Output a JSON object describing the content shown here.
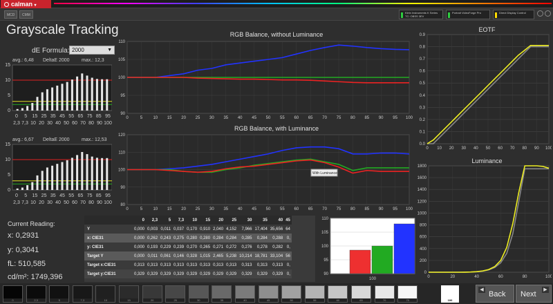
{
  "app": {
    "logo_text": "calman",
    "tabs": [
      "MCD",
      "CMM"
    ]
  },
  "toolbar": {
    "devices": [
      {
        "line1": "Klein Instruments K Series",
        "line2": "TC: OBSS 3EV",
        "color": "#2ecc40"
      },
      {
        "line1": "Portrait VideoForge Pro",
        "line2": "",
        "color": "#2ecc40"
      },
      {
        "line1": "Direct Display Control",
        "line2": "",
        "color": "#ffdc00"
      }
    ]
  },
  "page": {
    "title": "Grayscale Tracking",
    "de_formula_label": "dE Formula:",
    "de_formula_value": "2000"
  },
  "mini_charts": [
    {
      "avg": "avg.: 6,48",
      "label": "DeltaE 2000",
      "max": "max.: 12,3",
      "values": [
        0.5,
        0.8,
        1.5,
        2.5,
        4.5,
        6,
        7,
        7.6,
        8.2,
        8.8,
        9.4,
        10.2,
        11.2,
        12.2,
        11.5,
        10.8,
        10.4,
        10.3,
        10.3
      ],
      "yticks": [
        "15",
        "10",
        "5",
        "0"
      ],
      "xticks_row1": [
        "0",
        "5",
        "15",
        "25",
        "35",
        "45",
        "55",
        "65",
        "75",
        "85",
        "95"
      ],
      "xticks_row2": [
        "2,3",
        "7,3",
        "10",
        "20",
        "30",
        "40",
        "50",
        "60",
        "70",
        "80",
        "90",
        "100"
      ]
    },
    {
      "avg": "avg.: 6,67",
      "label": "DeltaE 2000",
      "max": "max.: 12,53",
      "values": [
        0.5,
        0.8,
        1.6,
        2.6,
        4.8,
        6.3,
        7.4,
        8,
        8.6,
        9.2,
        9.8,
        10.6,
        11.5,
        12.5,
        11.8,
        11,
        10.6,
        10.5,
        10.5
      ],
      "yticks": [
        "15",
        "10",
        "5",
        "0"
      ],
      "xticks_row1": [
        "0",
        "5",
        "15",
        "25",
        "35",
        "45",
        "55",
        "65",
        "75",
        "85",
        "95"
      ],
      "xticks_row2": [
        "2,3",
        "7,3",
        "10",
        "20",
        "30",
        "40",
        "50",
        "60",
        "70",
        "80",
        "90",
        "100"
      ]
    }
  ],
  "reading": {
    "title": "Current Reading:",
    "x": "x: 0,2931",
    "y": "y: 0,3041",
    "fl": "fL: 510,585",
    "cdm2": "cd/m²: 1749,396"
  },
  "chart_data": [
    {
      "type": "line",
      "title": "RGB Balance, without Luminance",
      "x": [
        0,
        5,
        10,
        15,
        20,
        25,
        30,
        35,
        40,
        45,
        50,
        55,
        60,
        65,
        70,
        75,
        80,
        85,
        90,
        95,
        100
      ],
      "ylim": [
        90,
        110
      ],
      "yticks": [
        90,
        95,
        100,
        105,
        110
      ],
      "series": [
        {
          "color": "#2233ff",
          "values": [
            100,
            100,
            100,
            100.5,
            101,
            102,
            102.5,
            103.5,
            104,
            104.5,
            105,
            105.5,
            106.5,
            107.5,
            108.3,
            109,
            108.7,
            108.3,
            108,
            107.8,
            107.7
          ]
        },
        {
          "color": "#22aa22",
          "values": [
            100,
            100,
            100,
            100,
            100,
            100,
            100,
            100,
            100,
            100,
            100,
            100,
            100,
            100,
            100,
            100,
            100,
            100,
            100,
            100,
            100
          ]
        },
        {
          "color": "#ee2222",
          "values": [
            100,
            100,
            100,
            100,
            100,
            99.8,
            99.7,
            99.6,
            99.5,
            99.5,
            99.4,
            99.3,
            99.3,
            99.2,
            99,
            98.8,
            98.6,
            98.5,
            98.5,
            98.5,
            98.5
          ]
        }
      ]
    },
    {
      "type": "line",
      "title": "RGB Balance, with Luminance",
      "x": [
        0,
        5,
        10,
        15,
        20,
        25,
        30,
        35,
        40,
        45,
        50,
        55,
        60,
        65,
        70,
        75,
        80,
        85,
        90,
        95,
        100
      ],
      "ylim": [
        80,
        120
      ],
      "yticks": [
        80,
        90,
        100,
        110,
        120
      ],
      "tooltip": "With Luminance",
      "series": [
        {
          "color": "#2233ff",
          "values": [
            100,
            100,
            100,
            100.5,
            101,
            102,
            103,
            104.5,
            106,
            107.5,
            109,
            111,
            112.5,
            113,
            113,
            112,
            109,
            109,
            109.5,
            109.5,
            109
          ]
        },
        {
          "color": "#22aa22",
          "values": [
            100,
            100,
            100,
            100,
            99,
            98.5,
            98.5,
            100,
            101,
            102.5,
            103.5,
            104.5,
            105.5,
            106,
            104.5,
            103,
            99.5,
            101,
            101,
            101,
            101
          ]
        },
        {
          "color": "#ee2222",
          "values": [
            100,
            100,
            100,
            99.5,
            99,
            98.5,
            99,
            100.5,
            101.5,
            102,
            103,
            104,
            105,
            105.5,
            104,
            101.5,
            98,
            99.5,
            99,
            99,
            99
          ]
        }
      ]
    },
    {
      "type": "bar",
      "categories": [
        "R",
        "G",
        "B"
      ],
      "values": [
        98.5,
        100,
        108
      ],
      "colors": [
        "#ee3030",
        "#22aa22",
        "#2233ff"
      ],
      "ylim": [
        90,
        110
      ],
      "yticks": [
        90,
        95,
        100,
        105,
        110
      ],
      "xlabel": "100"
    },
    {
      "type": "line",
      "title": "EOTF",
      "x": [
        0,
        5,
        10,
        15,
        20,
        25,
        30,
        35,
        40,
        45,
        50,
        55,
        60,
        65,
        70,
        75,
        80,
        85,
        90,
        95,
        100
      ],
      "ylim": [
        0,
        0.9
      ],
      "yticks": [
        0,
        0.1,
        0.2,
        0.3,
        0.4,
        0.5,
        0.6,
        0.7,
        0.8,
        0.9
      ],
      "series": [
        {
          "color": "#888888",
          "values": [
            0,
            0,
            0.05,
            0.1,
            0.15,
            0.2,
            0.25,
            0.3,
            0.35,
            0.4,
            0.45,
            0.5,
            0.55,
            0.6,
            0.65,
            0.7,
            0.75,
            0.8,
            0.8,
            0.8,
            0.8
          ]
        },
        {
          "color": "#eeee22",
          "values": [
            0,
            0.03,
            0.08,
            0.13,
            0.18,
            0.23,
            0.28,
            0.33,
            0.38,
            0.43,
            0.48,
            0.53,
            0.58,
            0.63,
            0.68,
            0.73,
            0.77,
            0.81,
            0.81,
            0.81,
            0.81
          ]
        }
      ]
    },
    {
      "type": "line",
      "title": "Luminance",
      "x": [
        0,
        5,
        10,
        15,
        20,
        25,
        30,
        35,
        40,
        45,
        50,
        55,
        60,
        65,
        70,
        75,
        80,
        85,
        90,
        95,
        100
      ],
      "ylim": [
        0,
        1800
      ],
      "yticks": [
        0,
        200,
        400,
        600,
        800,
        1000,
        1200,
        1400,
        1600,
        1800
      ],
      "series": [
        {
          "color": "#888888",
          "values": [
            0,
            0,
            0,
            0,
            0,
            0,
            1,
            3,
            8,
            18,
            40,
            80,
            160,
            320,
            650,
            1200,
            1750,
            1750,
            1750,
            1750,
            1750
          ]
        },
        {
          "color": "#eeee22",
          "values": [
            0,
            0,
            0,
            0,
            0,
            0,
            1,
            4,
            10,
            22,
            45,
            95,
            200,
            420,
            820,
            1350,
            1800,
            1800,
            1800,
            1790,
            1760
          ]
        }
      ]
    }
  ],
  "table": {
    "headers": [
      "",
      "0",
      "2,3",
      "5",
      "7,3",
      "10",
      "15",
      "20",
      "25",
      "30",
      "35",
      "40",
      "45"
    ],
    "rows": [
      {
        "label": "Y",
        "cells": [
          "0,000",
          "0,003",
          "0,011",
          "0,037",
          "0,170",
          "0,910",
          "2,040",
          "4,152",
          "7,966",
          "17,404",
          "35,656",
          "64"
        ]
      },
      {
        "label": "x: CIE31",
        "cells": [
          "0,000",
          "0,262",
          "0,243",
          "0,275",
          "0,280",
          "0,280",
          "0,284",
          "0,284",
          "0,285",
          "0,284",
          "0,288",
          "0,"
        ]
      },
      {
        "label": "y: CIE31",
        "cells": [
          "0,000",
          "0,193",
          "0,229",
          "0,239",
          "0,270",
          "0,265",
          "0,271",
          "0,272",
          "0,276",
          "0,278",
          "0,282",
          "0,"
        ]
      },
      {
        "label": "Target Y",
        "cells": [
          "0,000",
          "0,011",
          "0,061",
          "0,146",
          "0,328",
          "1,015",
          "2,465",
          "5,238",
          "10,214",
          "18,781",
          "33,104",
          "56"
        ]
      },
      {
        "label": "Target x:CIE31",
        "cells": [
          "0,313",
          "0,313",
          "0,313",
          "0,313",
          "0,313",
          "0,313",
          "0,313",
          "0,313",
          "0,313",
          "0,313",
          "0,313",
          "0,"
        ]
      },
      {
        "label": "Target y:CIE31",
        "cells": [
          "0,329",
          "0,329",
          "0,329",
          "0,329",
          "0,329",
          "0,329",
          "0,329",
          "0,329",
          "0,329",
          "0,329",
          "0,329",
          "0,"
        ]
      }
    ]
  },
  "swatches": {
    "grays": [
      "#050505",
      "#0b0b0b",
      "#111111",
      "#181818",
      "#202020",
      "#2b2b2b",
      "#383838",
      "#474747",
      "#575757",
      "#696969",
      "#7b7b7b",
      "#8e8e8e",
      "#a1a1a1",
      "#b4b4b4",
      "#c6c6c6",
      "#d8d8d8",
      "#e8e8e8",
      "#f6f6f6",
      "#ffffff"
    ],
    "labels": [
      "0",
      "2,3",
      "5",
      "7,3",
      "10",
      "15",
      "20",
      "25",
      "30",
      "35",
      "40",
      "45",
      "50",
      "55",
      "60",
      "65",
      "70",
      "75",
      "100"
    ],
    "selected_label": "100"
  },
  "nav": {
    "back_label": "Back",
    "next_label": "Next"
  }
}
